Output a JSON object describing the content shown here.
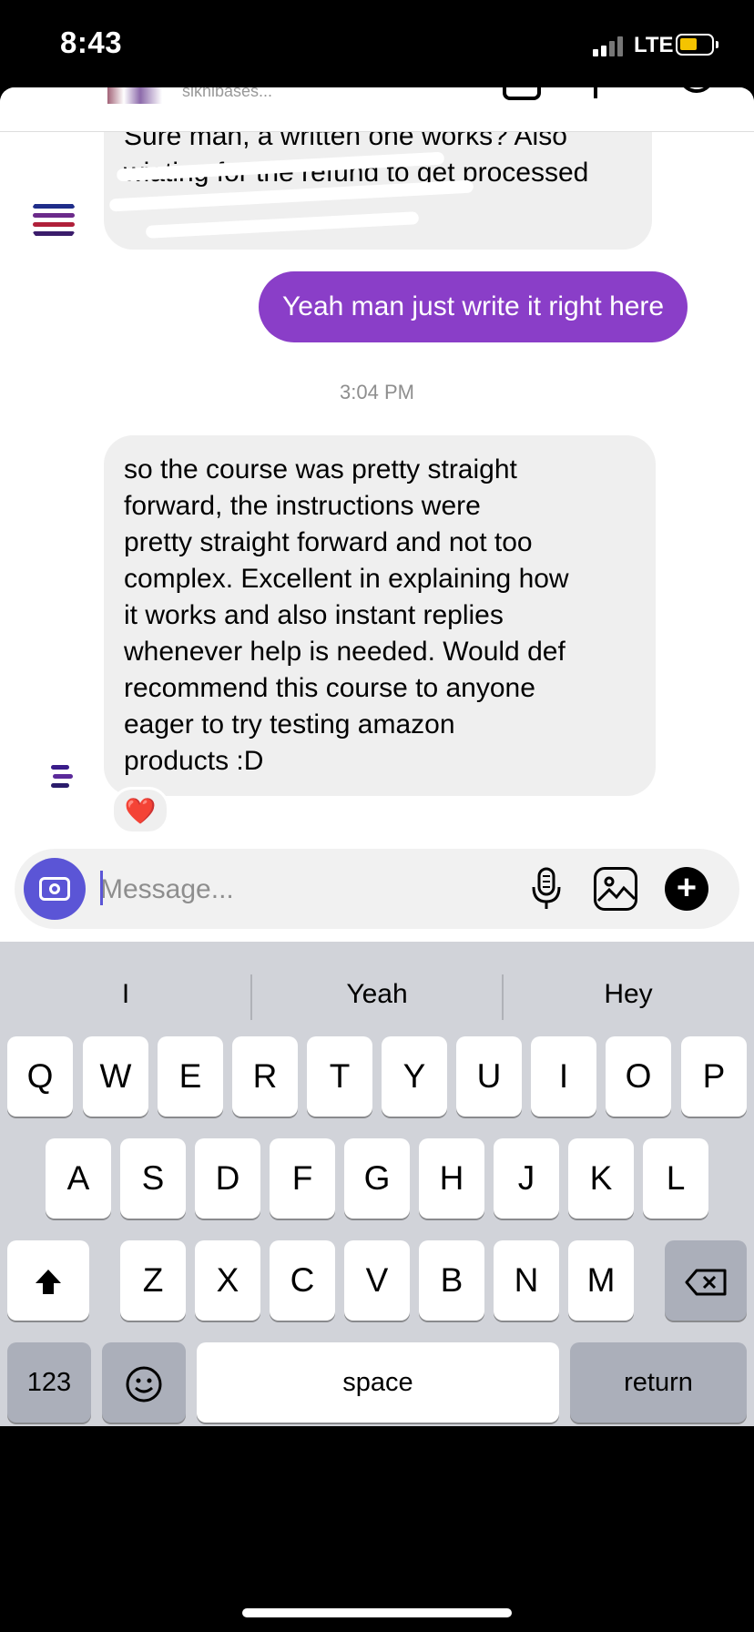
{
  "status": {
    "time": "8:43",
    "network": "LTE"
  },
  "header": {
    "name": "sikhibases..."
  },
  "messages": {
    "incoming_1": "Sure man, a written one works? Also wiating for the refund to get processed",
    "outgoing_1": "Yeah man just write it right here",
    "timestamp": "3:04 PM",
    "incoming_2_lines": [
      "so the course was pretty straight",
      "forward, the instructions were",
      "pretty straight forward and not too",
      "complex. Excellent in explaining how",
      "it works and also instant replies",
      "whenever help is needed. Would def",
      "recommend this course to anyone",
      "eager to try testing amazon",
      "products :D"
    ],
    "reaction": "❤️"
  },
  "composer": {
    "placeholder": "Message..."
  },
  "keyboard": {
    "suggestions": [
      "I",
      "Yeah",
      "Hey"
    ],
    "row1": [
      "Q",
      "W",
      "E",
      "R",
      "T",
      "Y",
      "U",
      "I",
      "O",
      "P"
    ],
    "row2": [
      "A",
      "S",
      "D",
      "F",
      "G",
      "H",
      "J",
      "K",
      "L"
    ],
    "row3": [
      "Z",
      "X",
      "C",
      "V",
      "B",
      "N",
      "M"
    ],
    "numbers": "123",
    "space": "space",
    "return": "return"
  }
}
